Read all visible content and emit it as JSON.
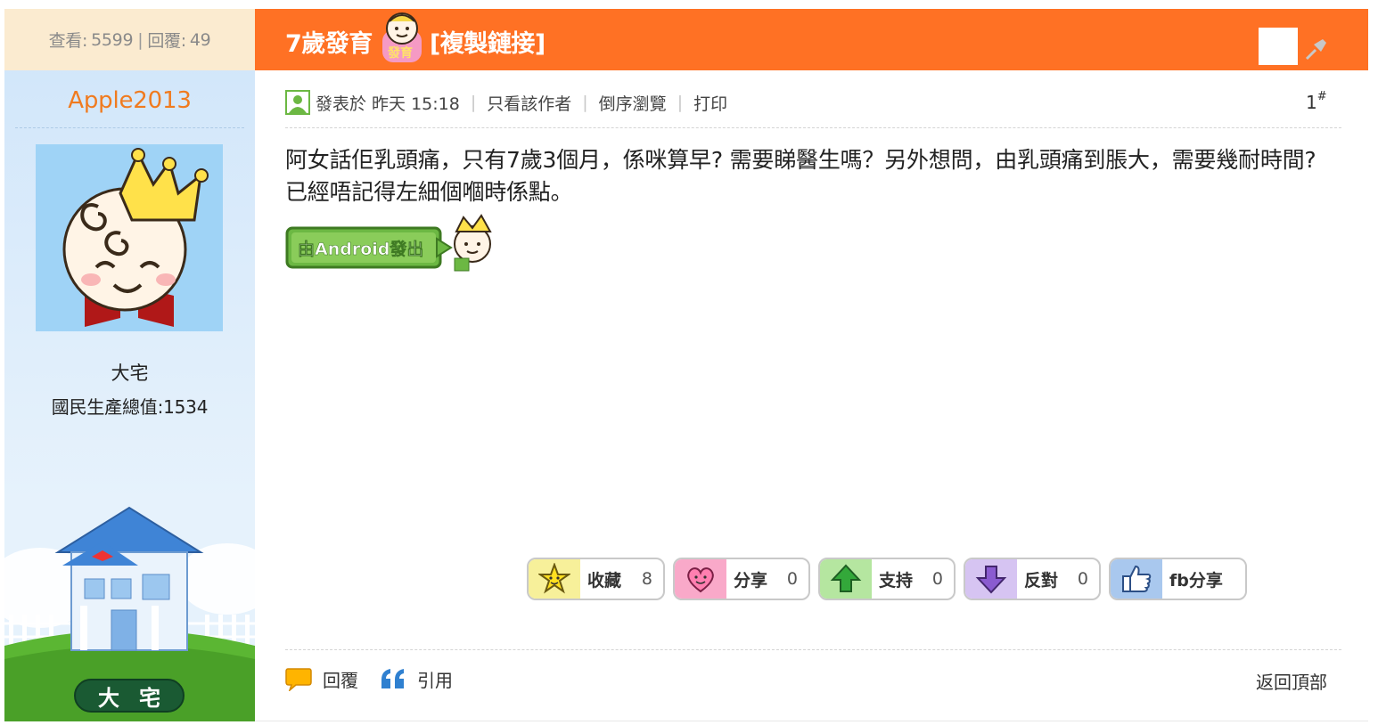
{
  "author": {
    "stats": {
      "views_label": "查看:",
      "views": "5599",
      "separator": "|",
      "replies_label": "回覆:",
      "replies": "49"
    },
    "username": "Apple2013",
    "rank_title": "大宅",
    "gnp": "國民生產總值:1534",
    "rank_badge": "大宅"
  },
  "thread": {
    "title": "7歲發育",
    "copy_link": "[複製鏈接]"
  },
  "meta": {
    "posted": "發表於 昨天 15:18",
    "only_author": "只看該作者",
    "reverse": "倒序瀏覽",
    "print": "打印",
    "floor": "1",
    "floor_mark": "#"
  },
  "post": {
    "body": "阿女話佢乳頭痛，只有7歲3個月，係咪算早? 需要睇醫生嗎？另外想問，由乳頭痛到脹大，需要幾耐時間? 已經唔記得左細個嗰時係點。",
    "android_badge": "由Android發出"
  },
  "actions": [
    {
      "label": "收藏",
      "count": "8",
      "icon": "star-icon",
      "color": "#f7f09a"
    },
    {
      "label": "分享",
      "count": "0",
      "icon": "heart-icon",
      "color": "#f9a9c9"
    },
    {
      "label": "支持",
      "count": "0",
      "icon": "arrow-up-icon",
      "color": "#b5e6a0"
    },
    {
      "label": "反對",
      "count": "0",
      "icon": "arrow-down-icon",
      "color": "#d6c4f2"
    },
    {
      "label": "fb分享",
      "count": "",
      "icon": "thumbs-up-icon",
      "color": "#a9c8ee"
    }
  ],
  "footer": {
    "reply": "回覆",
    "quote": "引用",
    "back_top": "返回頂部"
  },
  "colors": {
    "accent": "#ff7124",
    "username": "#f07b1f",
    "sidebar": "#d9ebfa"
  }
}
